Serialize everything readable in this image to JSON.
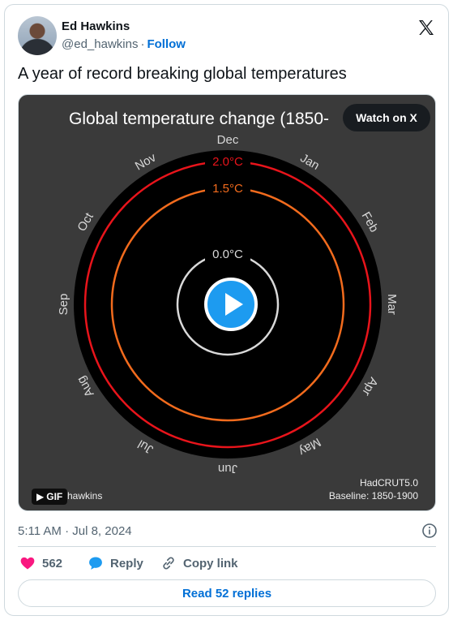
{
  "author": {
    "name": "Ed Hawkins",
    "handle": "@ed_hawkins",
    "separator": "·",
    "follow_label": "Follow"
  },
  "tweet": {
    "text": "A year of record breaking global temperatures"
  },
  "media": {
    "title": "Global temperature change (1850-",
    "watch_label": "Watch on X",
    "gif_label": "GIF",
    "credit": "@ed_hawkins",
    "credit_visible": "hawkins",
    "dataset": "HadCRUT5.0",
    "baseline": "Baseline: 1850-1900",
    "months": [
      "Dec",
      "Jan",
      "Feb",
      "Mar",
      "Apr",
      "May",
      "Jun",
      "Jul",
      "Aug",
      "Sep",
      "Oct",
      "Nov"
    ],
    "rings": [
      {
        "label": "2.0°C",
        "color": "#e8141b"
      },
      {
        "label": "1.5°C",
        "color": "#f26b1d"
      },
      {
        "label": "0.0°C",
        "color": "#d9d9d9"
      }
    ]
  },
  "meta": {
    "timestamp": "5:11 AM · Jul 8, 2024"
  },
  "actions": {
    "likes": "562",
    "reply_label": "Reply",
    "copy_label": "Copy link"
  },
  "footer": {
    "replies_label": "Read 52 replies"
  },
  "colors": {
    "accent": "#1d9bf0",
    "link": "#006fd6",
    "like": "#f91880"
  }
}
